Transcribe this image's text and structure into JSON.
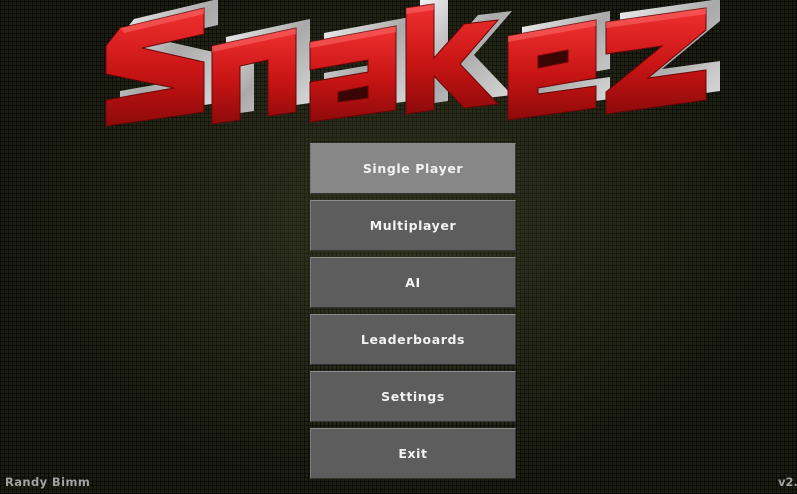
{
  "logo": {
    "text": "Snakez",
    "color_front": "#d01b1b",
    "color_side": "#c8c8c8"
  },
  "menu": {
    "items": [
      {
        "label": "Single Player",
        "selected": true
      },
      {
        "label": "Multiplayer",
        "selected": false
      },
      {
        "label": "AI",
        "selected": false
      },
      {
        "label": "Leaderboards",
        "selected": false
      },
      {
        "label": "Settings",
        "selected": false
      },
      {
        "label": "Exit",
        "selected": false
      }
    ]
  },
  "footer": {
    "author": "Randy Bimm",
    "version": "v2."
  }
}
